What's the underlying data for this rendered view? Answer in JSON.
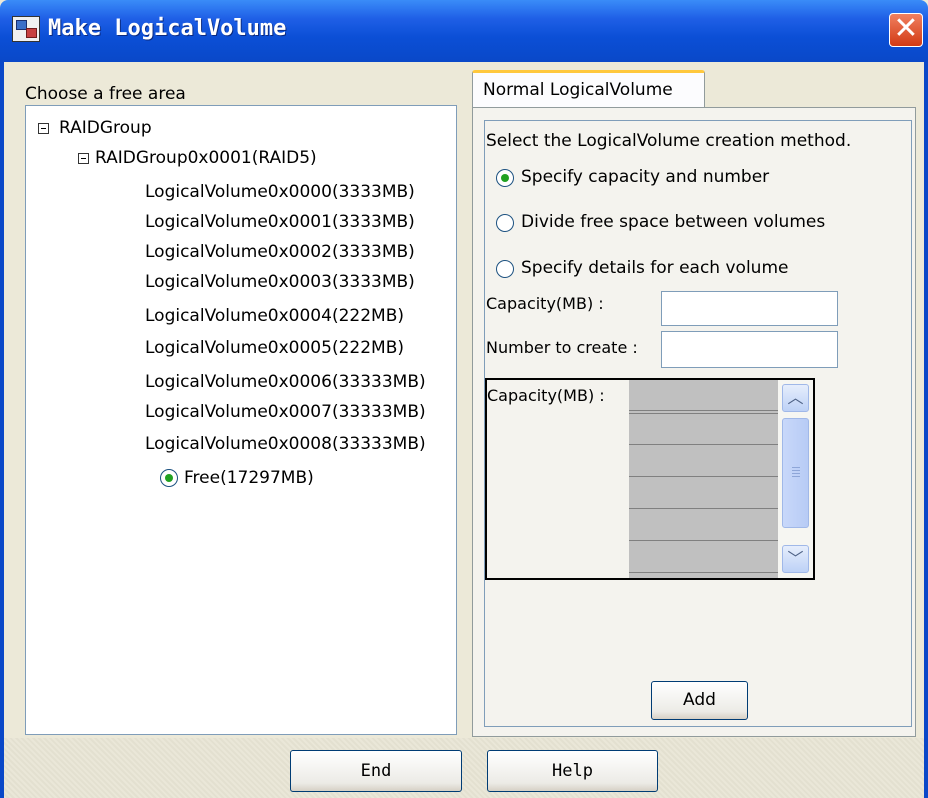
{
  "window": {
    "title": "Make LogicalVolume",
    "close_label": "✕",
    "accent": "#0a48c8"
  },
  "left_panel": {
    "label": "Choose a free area",
    "tree": {
      "root": "RAIDGroup",
      "group": "RAIDGroup0x0001(RAID5)",
      "volumes": [
        "LogicalVolume0x0000(3333MB)",
        "LogicalVolume0x0001(3333MB)",
        "LogicalVolume0x0002(3333MB)",
        "LogicalVolume0x0003(3333MB)",
        "LogicalVolume0x0004(222MB)",
        "LogicalVolume0x0005(222MB)",
        "LogicalVolume0x0006(33333MB)",
        "LogicalVolume0x0007(33333MB)",
        "LogicalVolume0x0008(33333MB)"
      ],
      "free": "Free(17297MB)"
    }
  },
  "tabs": [
    {
      "label": "Normal LogicalVolume",
      "selected": true
    }
  ],
  "method": {
    "prompt": "Select the LogicalVolume creation method.",
    "options": [
      {
        "label": "Specify capacity and number",
        "checked": true
      },
      {
        "label": "Divide free space between volumes",
        "checked": false
      },
      {
        "label": "Specify details for each volume",
        "checked": false
      }
    ]
  },
  "fields": {
    "capacity_label": "Capacity(MB) :",
    "capacity_value": "",
    "number_label": "Number to create :",
    "number_value": ""
  },
  "detail_table": {
    "label": "Capacity(MB) :",
    "rows": [
      "",
      "",
      "",
      "",
      "",
      ""
    ]
  },
  "buttons": {
    "add": "Add",
    "end": "End",
    "help": "Help"
  }
}
